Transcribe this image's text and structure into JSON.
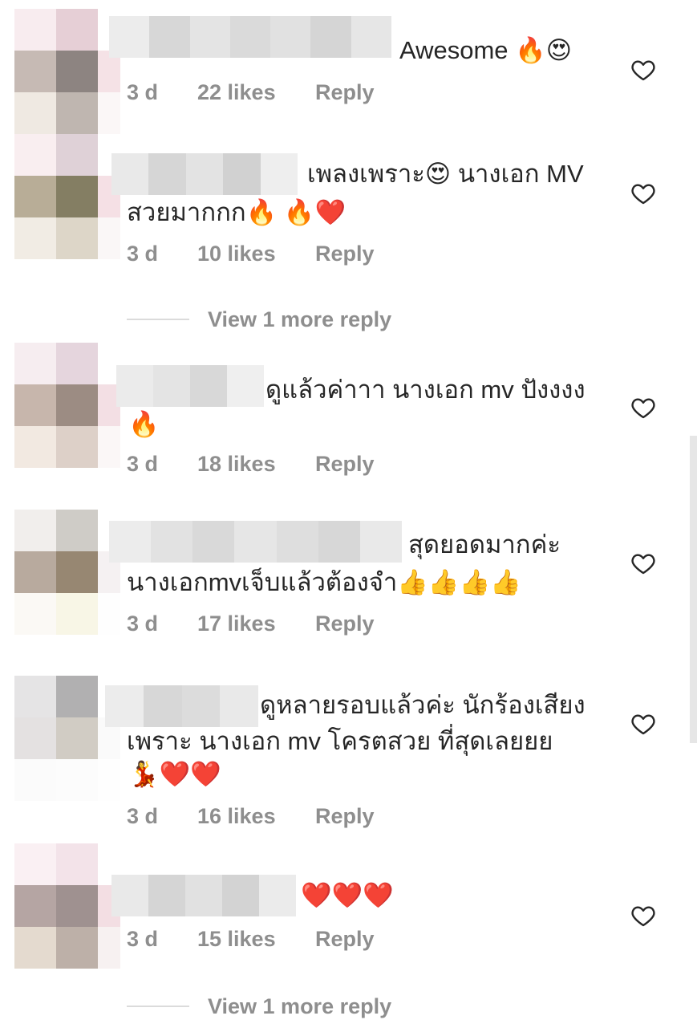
{
  "comments": [
    {
      "text_lines": [
        "Awesome 🔥😍"
      ],
      "time": "3 d",
      "likes": "22 likes",
      "reply": "Reply"
    },
    {
      "text_lines": [
        "เพลงเพราะ😍 นางเอก MV",
        "สวยมากกก🔥 🔥❤️"
      ],
      "time": "3 d",
      "likes": "10 likes",
      "reply": "Reply"
    },
    {
      "text_lines": [
        "ดูแล้วค่าาา นางเอก mv ปังงงง",
        "🔥"
      ],
      "time": "3 d",
      "likes": "18 likes",
      "reply": "Reply"
    },
    {
      "text_lines": [
        "สุดยอดมากค่ะ",
        "นางเอกmvเจ็บแล้วต้องจำ👍👍👍👍"
      ],
      "time": "3 d",
      "likes": "17 likes",
      "reply": "Reply"
    },
    {
      "text_lines": [
        "ดูหลายรอบแล้วค่ะ นักร้องเสียง",
        "เพราะ นางเอก mv โครตสวย ที่สุดเลยยย",
        "💃❤️❤️"
      ],
      "time": "3 d",
      "likes": "16 likes",
      "reply": "Reply"
    },
    {
      "text_lines": [
        "❤️❤️❤️"
      ],
      "time": "3 d",
      "likes": "15 likes",
      "reply": "Reply"
    }
  ],
  "view_more_replies": [
    "View 1 more reply",
    "View 1 more reply"
  ],
  "icons": {
    "like": "heart-outline-icon"
  },
  "colors": {
    "text": "#262626",
    "meta": "#8e8e8e",
    "heart_stroke": "#262626"
  }
}
